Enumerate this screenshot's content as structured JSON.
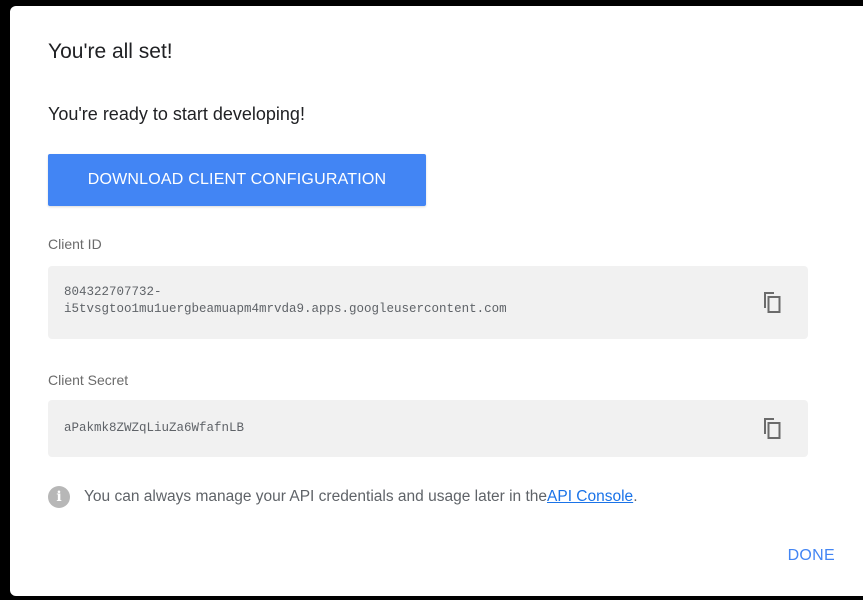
{
  "dialog": {
    "title": "You're all set!",
    "subtitle": "You're ready to start developing!",
    "download_button_label": "DOWNLOAD CLIENT CONFIGURATION",
    "client_id": {
      "label": "Client ID",
      "value_line1": "804322707732-",
      "value_line2": "i5tvsgtoo1mu1uergbeamuapm4mrvda9.apps.googleusercontent.com",
      "copy_icon": "copy-icon"
    },
    "client_secret": {
      "label": "Client Secret",
      "value": "aPakmk8ZWZqLiuZa6WfafnLB",
      "copy_icon": "copy-icon"
    },
    "info": {
      "icon": "info-icon",
      "text": "You can always manage your API credentials and usage later in the ",
      "link_text": "API Console",
      "period": "."
    },
    "done_button_label": "DONE"
  },
  "colors": {
    "accent": "#4285f4",
    "link": "#1a73e8",
    "field_background": "#f1f1f1"
  }
}
